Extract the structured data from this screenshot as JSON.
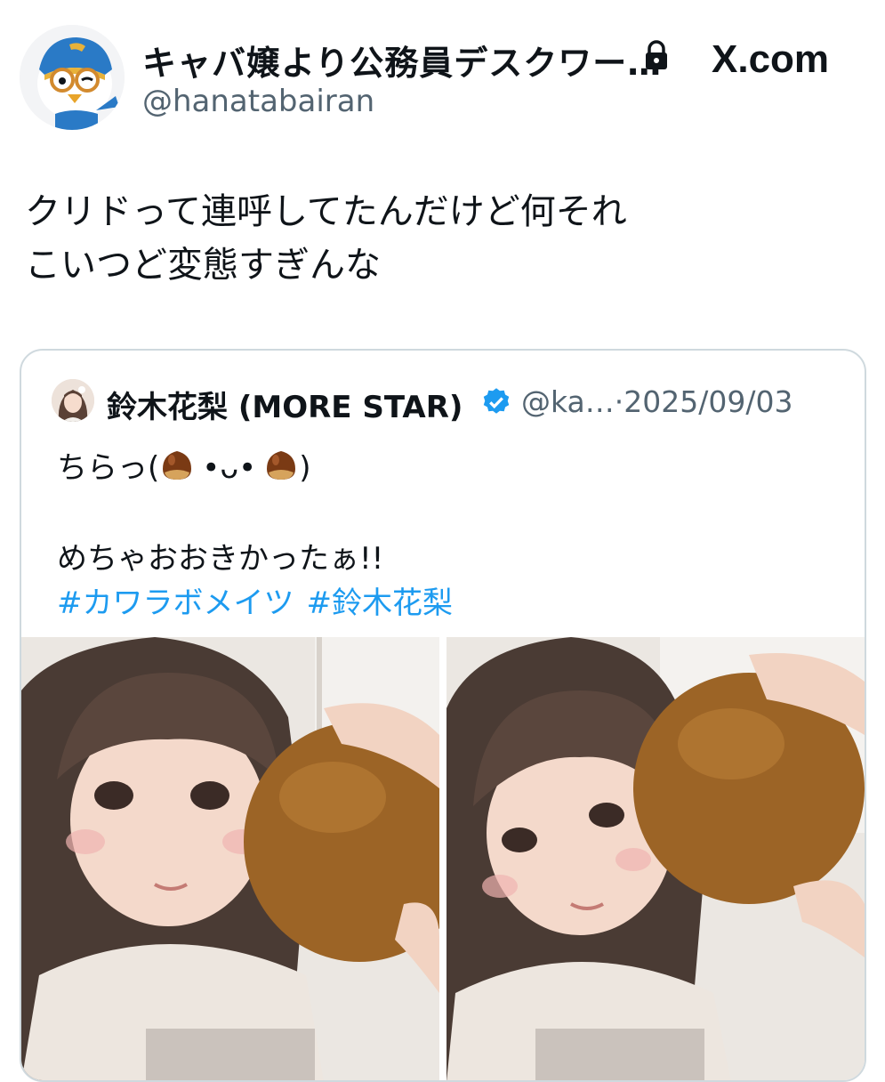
{
  "post": {
    "author_name": "キャバ嬢より公務員デスクワー…",
    "author_handle": "@hanatabairan",
    "brand": "X.com",
    "text_lines": [
      "クリドって連呼してたんだけど何それ",
      "こいつど変態すぎんな"
    ],
    "icons": [
      "lock-icon"
    ]
  },
  "quote": {
    "author_name": "鈴木花梨 (MORE STAR)",
    "author_handle": "@ka…",
    "separator": "·",
    "date": "2025/09/03",
    "line1_prefix": "ちらっ(",
    "line1_middle": "•ᴗ•",
    "line1_suffix": ")",
    "line2": "めちゃおおきかったぁ!!",
    "hashtags": [
      "#カワラボメイツ",
      "#鈴木花梨"
    ],
    "icons": [
      "verified-icon",
      "chestnut-emoji"
    ],
    "colors": {
      "link": "#1d9bf0",
      "verified": "#1d9bf0",
      "secondary_text": "#536471"
    }
  }
}
